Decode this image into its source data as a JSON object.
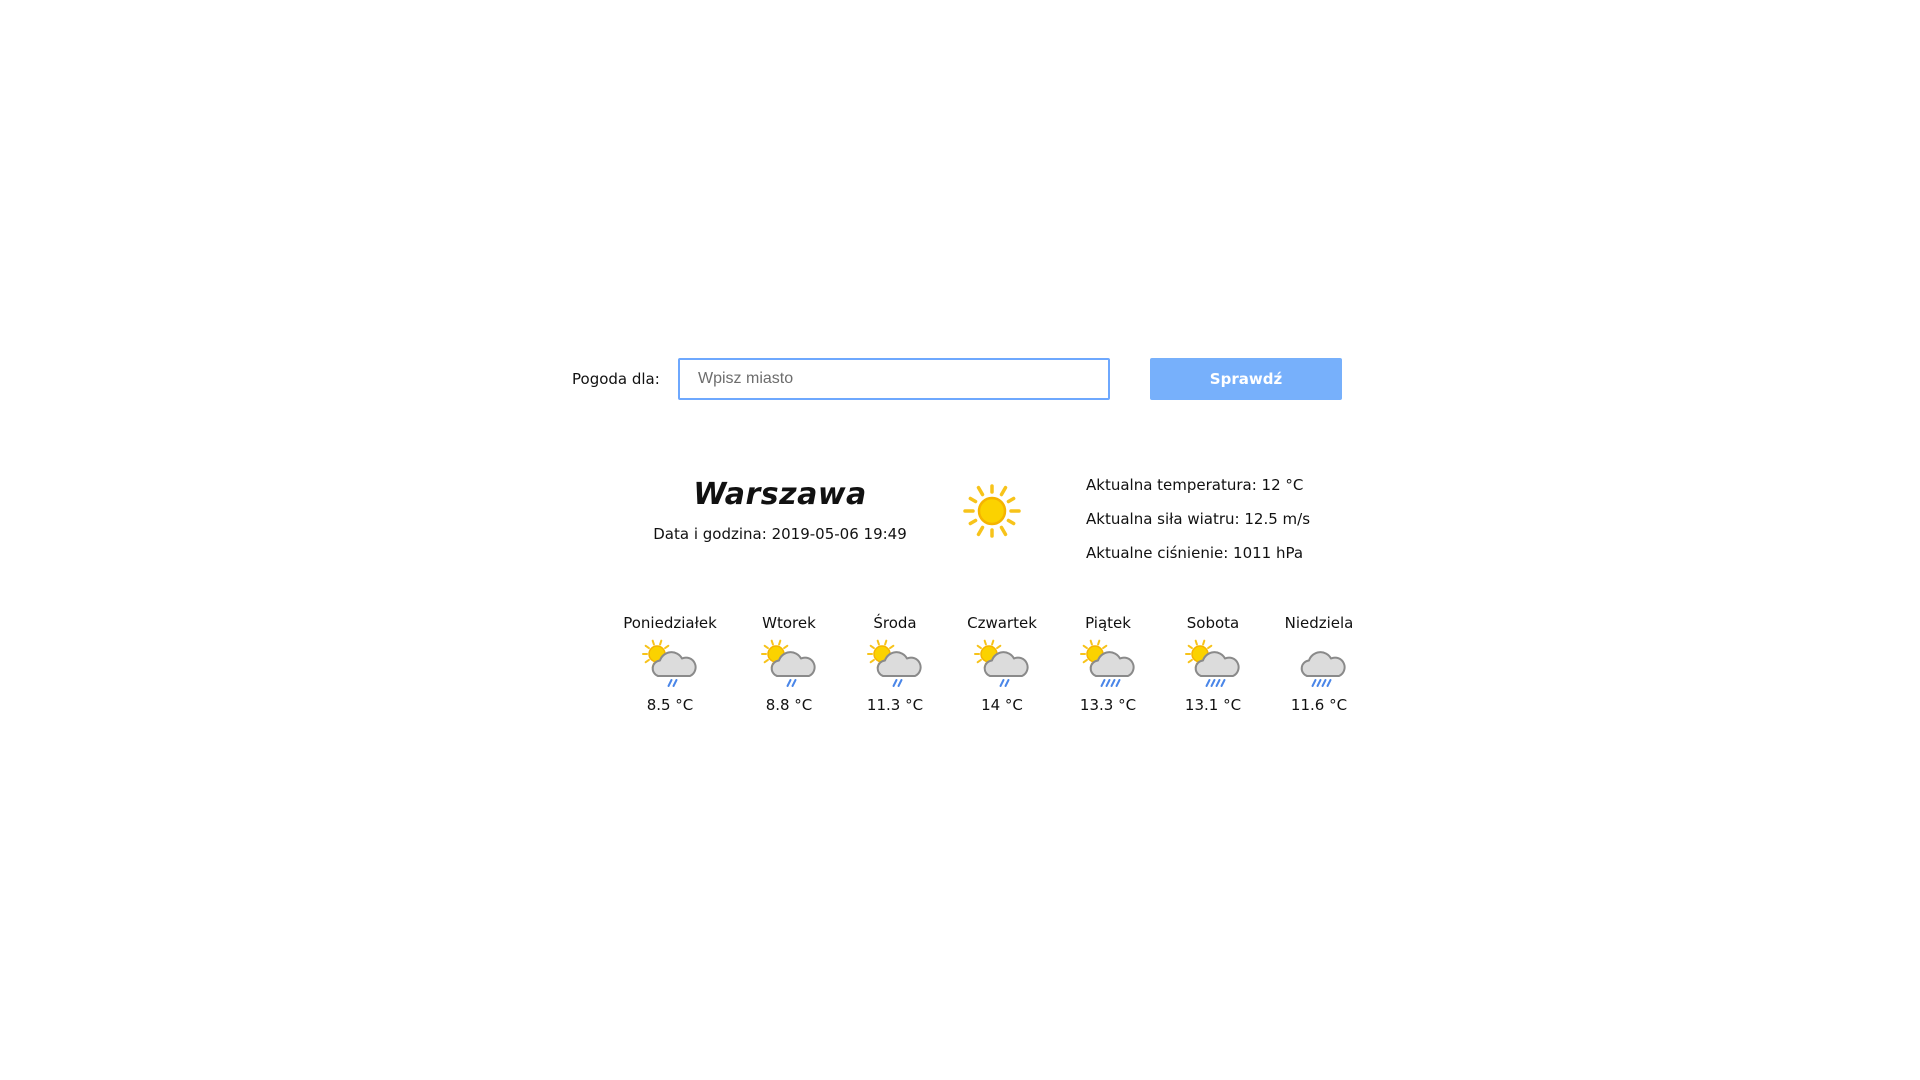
{
  "search": {
    "label": "Pogoda dla:",
    "placeholder": "Wpisz miasto",
    "value": "",
    "button_label": "Sprawdź"
  },
  "current": {
    "city": "Warszawa",
    "datetime_label": "Data i godzina:",
    "datetime_value": "2019-05-06 19:49",
    "icon": "sun-icon",
    "temperature_line": "Aktualna temperatura: 12 °C",
    "wind_line": "Aktualna siła wiatru: 12.5 m/s",
    "pressure_line": "Aktualne ciśnienie: 1011 hPa"
  },
  "forecast": [
    {
      "day": "Poniedziałek",
      "temp": "8.5 °C",
      "icon": "partly-cloudy-light-rain-icon"
    },
    {
      "day": "Wtorek",
      "temp": "8.8 °C",
      "icon": "partly-cloudy-light-rain-icon"
    },
    {
      "day": "Środa",
      "temp": "11.3 °C",
      "icon": "partly-cloudy-light-rain-icon"
    },
    {
      "day": "Czwartek",
      "temp": "14 °C",
      "icon": "partly-cloudy-light-rain-icon"
    },
    {
      "day": "Piątek",
      "temp": "13.3 °C",
      "icon": "partly-cloudy-heavy-rain-icon"
    },
    {
      "day": "Sobota",
      "temp": "13.1 °C",
      "icon": "partly-cloudy-heavy-rain-icon"
    },
    {
      "day": "Niedziela",
      "temp": "11.6 °C",
      "icon": "cloud-heavy-rain-icon"
    }
  ],
  "colors": {
    "accent": "#77b0fb",
    "input_border": "#6ea8fe",
    "sun": "#f7c31a",
    "cloud": "#d2d2d2",
    "rain": "#4a86e8"
  }
}
